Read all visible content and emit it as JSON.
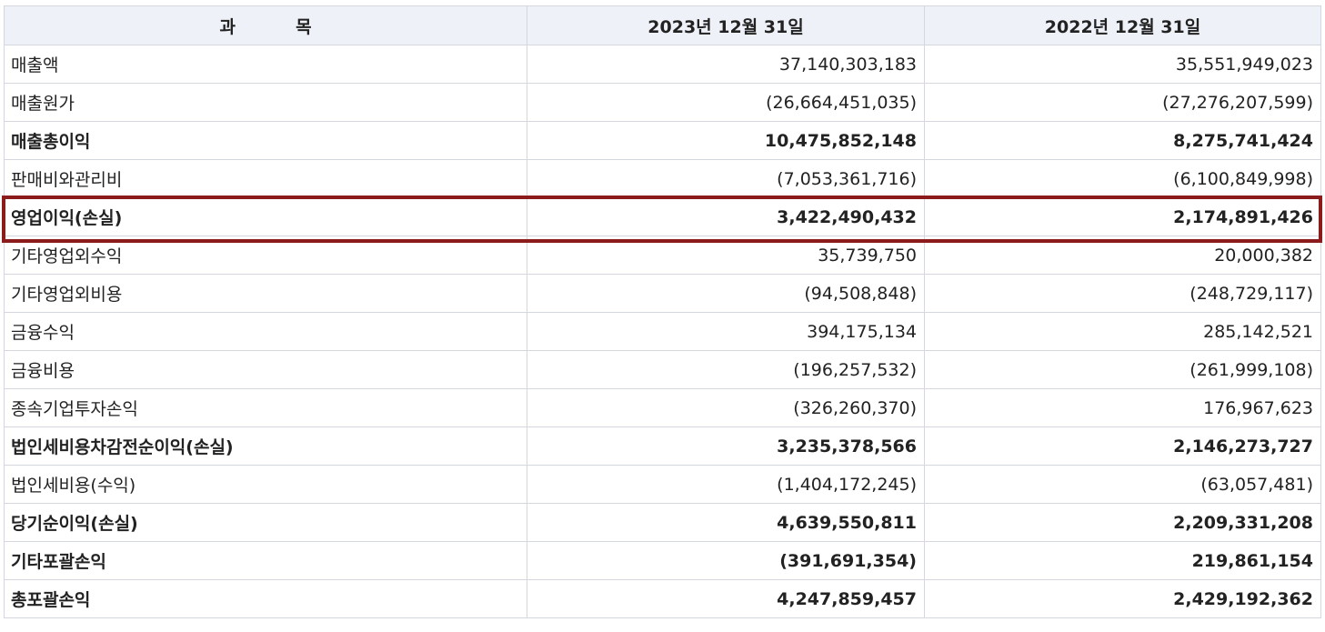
{
  "table": {
    "headers": [
      "과          목",
      "2023년 12월 31일",
      "2022년 12월 31일"
    ],
    "rows": [
      {
        "label": "매출액",
        "y2023": "37,140,303,183",
        "y2022": "35,551,949,023",
        "bold": false
      },
      {
        "label": "매출원가",
        "y2023": "(26,664,451,035)",
        "y2022": "(27,276,207,599)",
        "bold": false
      },
      {
        "label": "매출총이익",
        "y2023": "10,475,852,148",
        "y2022": "8,275,741,424",
        "bold": true
      },
      {
        "label": "판매비와관리비",
        "y2023": "(7,053,361,716)",
        "y2022": "(6,100,849,998)",
        "bold": false
      },
      {
        "label": "영업이익(손실)",
        "y2023": "3,422,490,432",
        "y2022": "2,174,891,426",
        "bold": true,
        "highlighted": true
      },
      {
        "label": "기타영업외수익",
        "y2023": "35,739,750",
        "y2022": "20,000,382",
        "bold": false
      },
      {
        "label": "기타영업외비용",
        "y2023": "(94,508,848)",
        "y2022": "(248,729,117)",
        "bold": false
      },
      {
        "label": "금융수익",
        "y2023": "394,175,134",
        "y2022": "285,142,521",
        "bold": false
      },
      {
        "label": "금융비용",
        "y2023": "(196,257,532)",
        "y2022": "(261,999,108)",
        "bold": false
      },
      {
        "label": "종속기업투자손익",
        "y2023": "(326,260,370)",
        "y2022": "176,967,623",
        "bold": false
      },
      {
        "label": "법인세비용차감전순이익(손실)",
        "y2023": "3,235,378,566",
        "y2022": "2,146,273,727",
        "bold": true
      },
      {
        "label": "법인세비용(수익)",
        "y2023": "(1,404,172,245)",
        "y2022": "(63,057,481)",
        "bold": false
      },
      {
        "label": "당기순이익(손실)",
        "y2023": "4,639,550,811",
        "y2022": "2,209,331,208",
        "bold": true
      },
      {
        "label": "기타포괄손익",
        "y2023": "(391,691,354)",
        "y2022": "219,861,154",
        "bold": true
      },
      {
        "label": "총포괄손익",
        "y2023": "4,247,859,457",
        "y2022": "2,429,192,362",
        "bold": true
      }
    ]
  },
  "colors": {
    "header_bg": "#eef1f8",
    "border": "#d4d7de",
    "highlight": "#8c1c1c",
    "text": "#222222"
  }
}
